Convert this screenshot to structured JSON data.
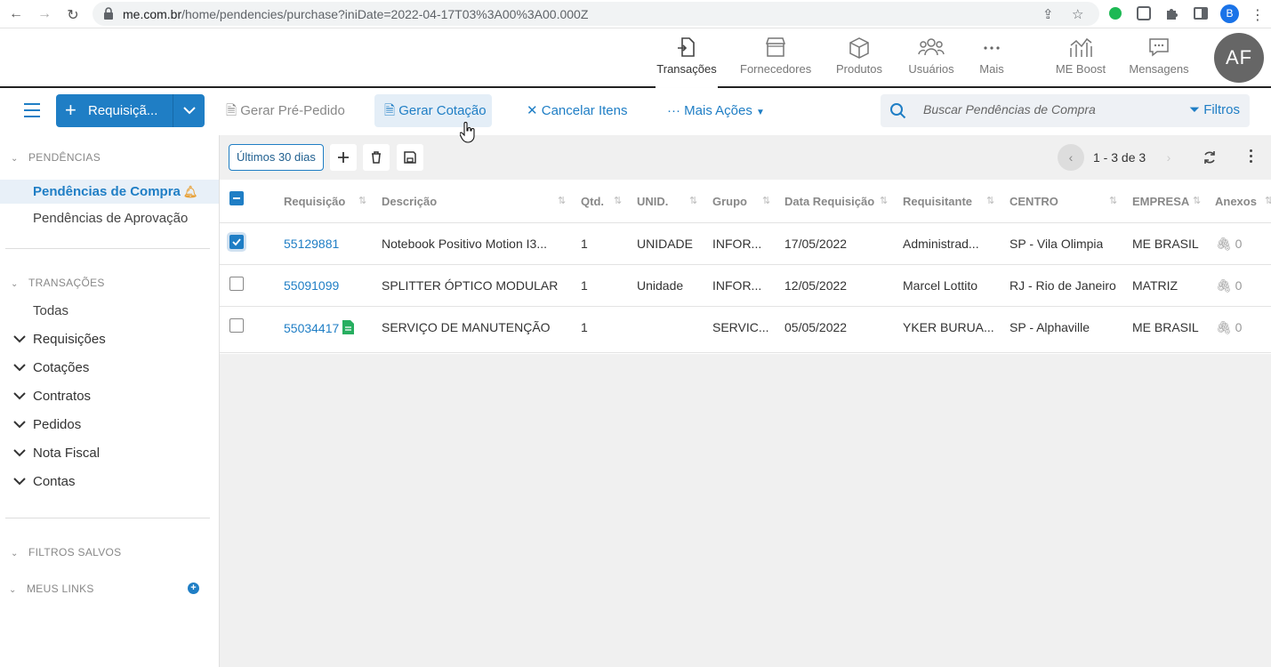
{
  "browser": {
    "url_host": "me.com.br",
    "url_path": "/home/pendencies/purchase?iniDate=2022-04-17T03%3A00%3A00.000Z",
    "profile_initial": "B"
  },
  "header": {
    "nav": [
      {
        "label": "Transações",
        "icon": "transfer-doc-icon"
      },
      {
        "label": "Fornecedores",
        "icon": "store-icon"
      },
      {
        "label": "Produtos",
        "icon": "box-icon"
      },
      {
        "label": "Usuários",
        "icon": "users-icon"
      },
      {
        "label": "Mais",
        "icon": "more-icon"
      },
      {
        "label": "ME Boost",
        "icon": "chart-icon"
      },
      {
        "label": "Mensagens",
        "icon": "chat-icon"
      }
    ],
    "avatar": "AF"
  },
  "toolbar": {
    "req_label": "Requisiçã...",
    "gerar_pre_pedido": "Gerar Pré-Pedido",
    "gerar_cotacao": "Gerar Cotação",
    "cancelar_itens": "Cancelar Itens",
    "mais_acoes": "Mais Ações",
    "search_placeholder": "Buscar Pendências de Compra",
    "filtros": "Filtros"
  },
  "sidebar": {
    "pendencias_header": "PENDÊNCIAS",
    "pendencias_compra": "Pendências de Compra",
    "pendencias_aprovacao": "Pendências de Aprovação",
    "transacoes_header": "TRANSAÇÕES",
    "todas": "Todas",
    "tree": [
      "Requisições",
      "Cotações",
      "Contratos",
      "Pedidos",
      "Nota Fiscal",
      "Contas"
    ],
    "filtros_salvos": "FILTROS SALVOS",
    "meus_links": "MEUS LINKS"
  },
  "main": {
    "period": "Últimos 30 dias",
    "pager": "1 - 3 de 3",
    "columns": [
      "Requisição",
      "Descrição",
      "Qtd.",
      "UNID.",
      "Grupo",
      "Data Requisição",
      "Requisitante",
      "CENTRO",
      "EMPRESA",
      "Anexos"
    ],
    "rows": [
      {
        "req": "55129881",
        "desc": "Notebook Positivo Motion I3...",
        "qtd": "1",
        "unid": "UNIDADE",
        "grupo": "INFOR...",
        "data": "17/05/2022",
        "requisitante": "Administrad...",
        "centro": "SP - Vila Olimpia",
        "empresa": "ME BRASIL",
        "anexos": "0",
        "checked": true
      },
      {
        "req": "55091099",
        "desc": "SPLITTER ÓPTICO MODULAR",
        "qtd": "1",
        "unid": "Unidade",
        "grupo": "INFOR...",
        "data": "12/05/2022",
        "requisitante": "Marcel Lottito",
        "centro": "RJ - Rio de Janeiro",
        "empresa": "MATRIZ",
        "anexos": "0",
        "checked": false
      },
      {
        "req": "55034417",
        "desc": "SERVIÇO DE MANUTENÇÃO",
        "qtd": "1",
        "unid": "",
        "grupo": "SERVIC...",
        "data": "05/05/2022",
        "requisitante": "YKER BURUA...",
        "centro": "SP - Alphaville",
        "empresa": "ME BRASIL",
        "anexos": "0",
        "checked": false
      }
    ]
  },
  "colors": {
    "primary": "#1f7ec5",
    "accent_bell": "#e8a23a",
    "doc_green": "#27ae60"
  }
}
